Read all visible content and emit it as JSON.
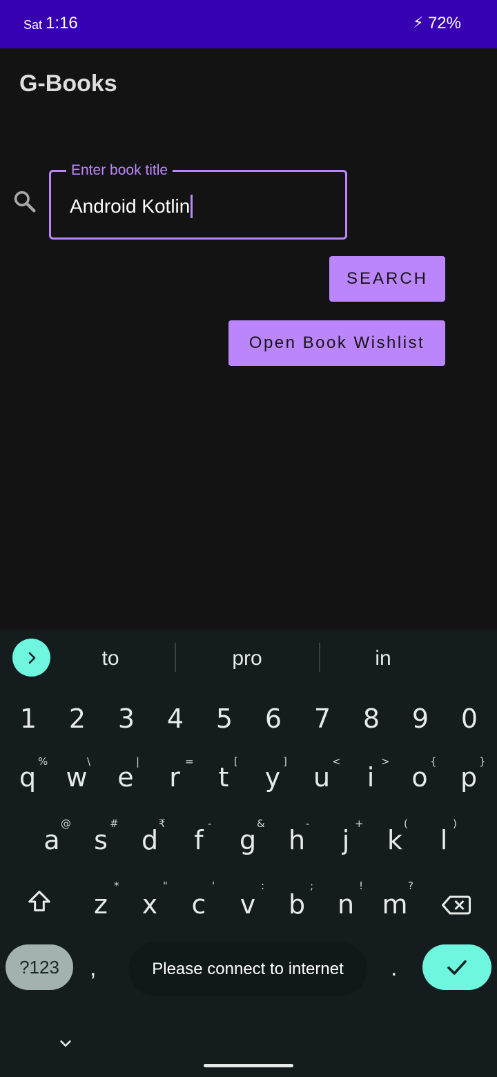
{
  "status_bar": {
    "day": "Sat",
    "time": "1:16",
    "battery": "72%",
    "charging_symbol": "⚡"
  },
  "app": {
    "title": "G-Books"
  },
  "search": {
    "label": "Enter book title",
    "value": "Android Kotlin",
    "button": "SEARCH"
  },
  "wishlist_button": "Open Book Wishlist",
  "keyboard": {
    "suggestions": [
      "to",
      "pro",
      "in"
    ],
    "numbers": [
      "1",
      "2",
      "3",
      "4",
      "5",
      "6",
      "7",
      "8",
      "9",
      "0"
    ],
    "row1": [
      {
        "k": "q",
        "h": "%"
      },
      {
        "k": "w",
        "h": "\\"
      },
      {
        "k": "e",
        "h": "|"
      },
      {
        "k": "r",
        "h": "="
      },
      {
        "k": "t",
        "h": "["
      },
      {
        "k": "y",
        "h": "]"
      },
      {
        "k": "u",
        "h": "<"
      },
      {
        "k": "i",
        "h": ">"
      },
      {
        "k": "o",
        "h": "{"
      },
      {
        "k": "p",
        "h": "}"
      }
    ],
    "row2": [
      {
        "k": "a",
        "h": "@"
      },
      {
        "k": "s",
        "h": "#"
      },
      {
        "k": "d",
        "h": "₹"
      },
      {
        "k": "f",
        "h": "-"
      },
      {
        "k": "g",
        "h": "&"
      },
      {
        "k": "h",
        "h": "-"
      },
      {
        "k": "j",
        "h": "+"
      },
      {
        "k": "k",
        "h": "("
      },
      {
        "k": "l",
        "h": ")"
      }
    ],
    "row3": [
      {
        "k": "z",
        "h": "*"
      },
      {
        "k": "x",
        "h": "\""
      },
      {
        "k": "c",
        "h": "'"
      },
      {
        "k": "v",
        "h": ":"
      },
      {
        "k": "b",
        "h": ";"
      },
      {
        "k": "n",
        "h": "!"
      },
      {
        "k": "m",
        "h": "?"
      }
    ],
    "symbols_key": "?123",
    "comma": ",",
    "period": ".",
    "toast": "Please connect to internet"
  },
  "icons": {
    "search": "search-icon",
    "shift": "shift-icon",
    "backspace": "backspace-icon",
    "enter": "check-icon",
    "collapse": "chevron-down-icon",
    "suggest": "chevron-right-icon"
  },
  "colors": {
    "status_bar": "#3700b3",
    "accent": "#bb86fc",
    "keyboard_accent": "#6ef6df",
    "background": "#141314"
  }
}
